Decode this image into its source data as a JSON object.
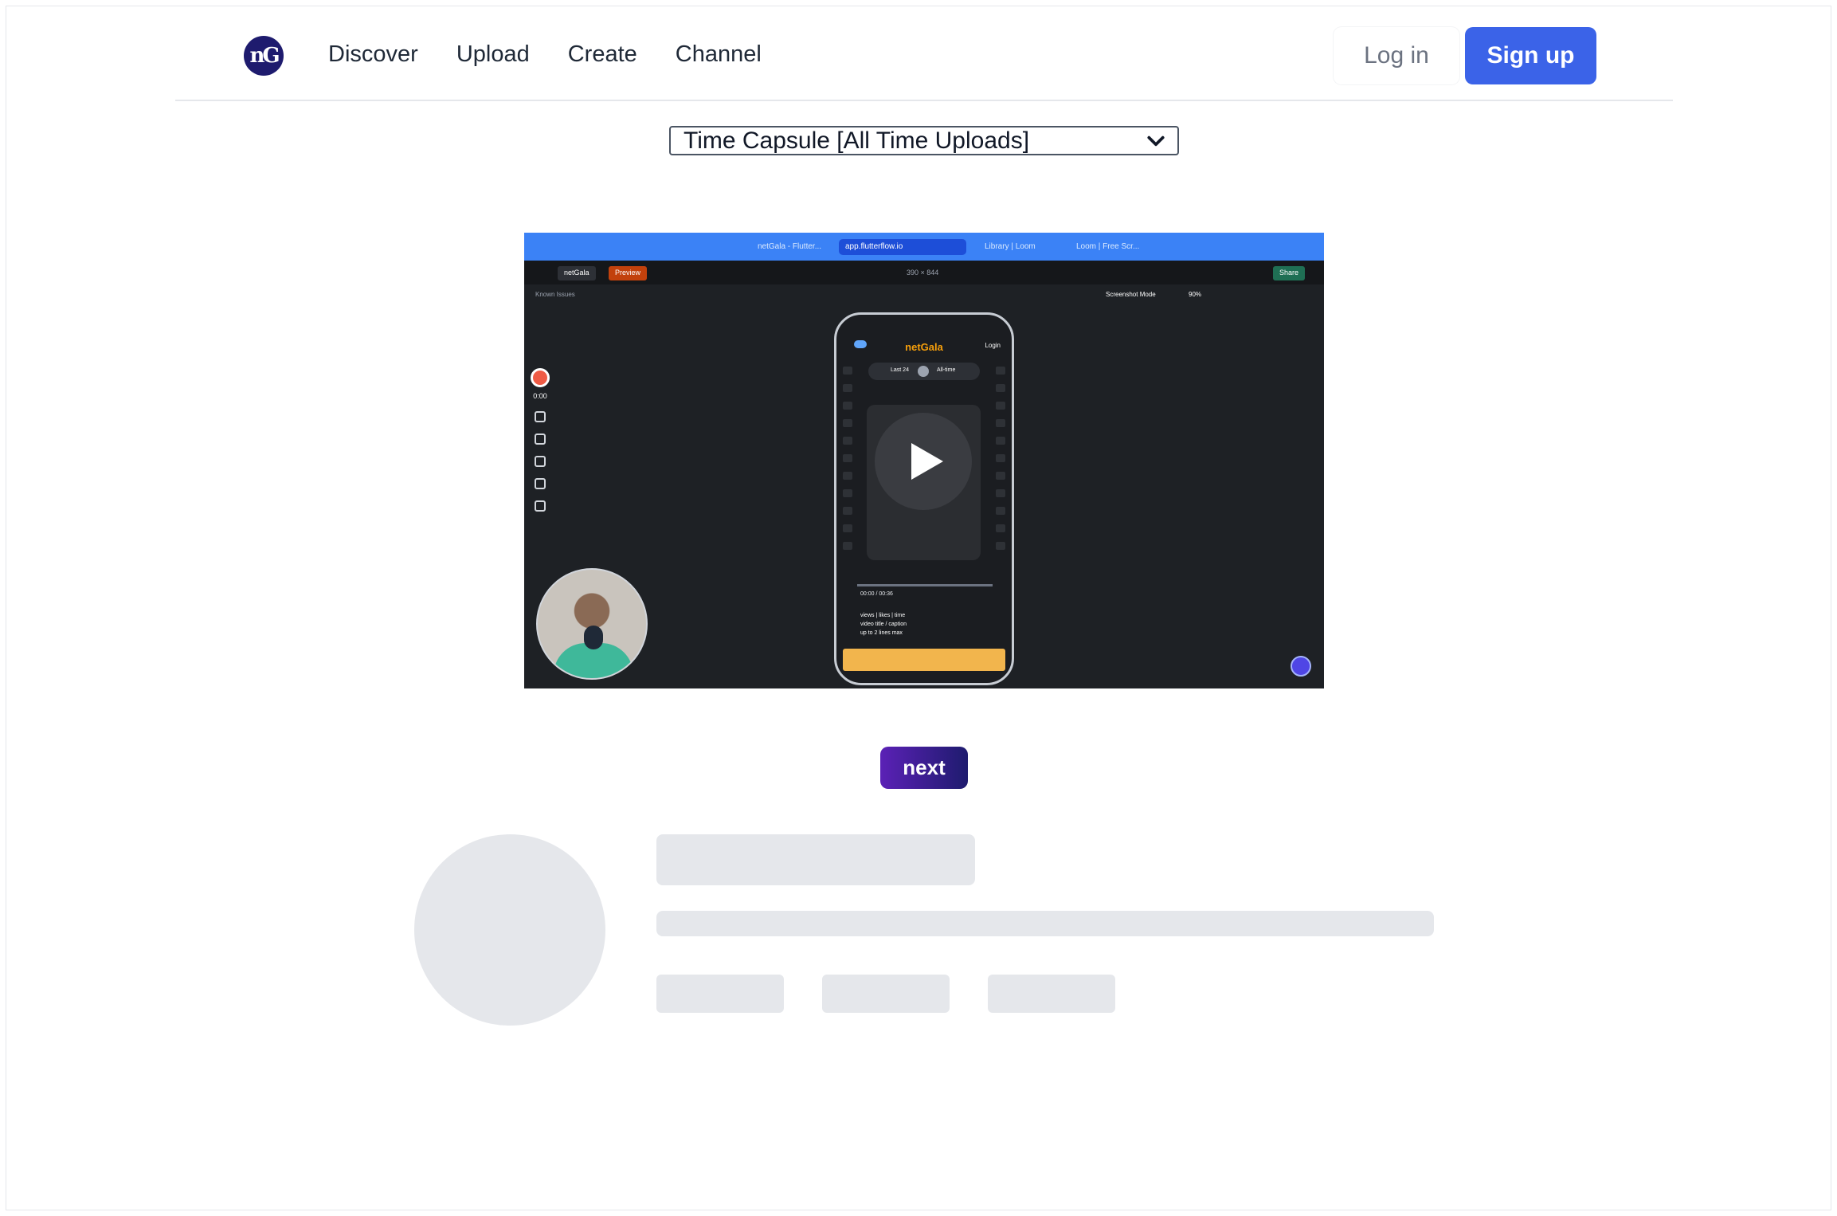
{
  "nav": {
    "logo_text": "nG",
    "links": [
      "Discover",
      "Upload",
      "Create",
      "Channel"
    ],
    "login_label": "Log in",
    "signup_label": "Sign up"
  },
  "filter": {
    "selected": "Time Capsule [All Time Uploads]"
  },
  "video": {
    "browser_tabs": [
      "netGala - Flutter...",
      "app.flutterflow.io",
      "Library | Loom",
      "Loom | Free Scr..."
    ],
    "project_name": "netGala",
    "preview_label": "Preview",
    "share_label": "Share",
    "known_issues": "Known Issues",
    "screenshot_mode": "Screenshot Mode",
    "zoom": "90%",
    "size_label": "390 × 844",
    "record_time": "0:00",
    "phone": {
      "title": "netGala",
      "login": "Login",
      "toggle_left": "Last 24",
      "toggle_right": "All-time",
      "time": "00:00 / 00:36",
      "meta_line": "views | likes | time",
      "caption_1": "video title / caption",
      "caption_2": "up to 2 lines max"
    }
  },
  "next_label": "next",
  "colors": {
    "primary": "#3b63e8",
    "next_gradient_start": "#5b21b6",
    "next_gradient_end": "#1e1b6e",
    "skeleton": "#e5e7eb"
  }
}
